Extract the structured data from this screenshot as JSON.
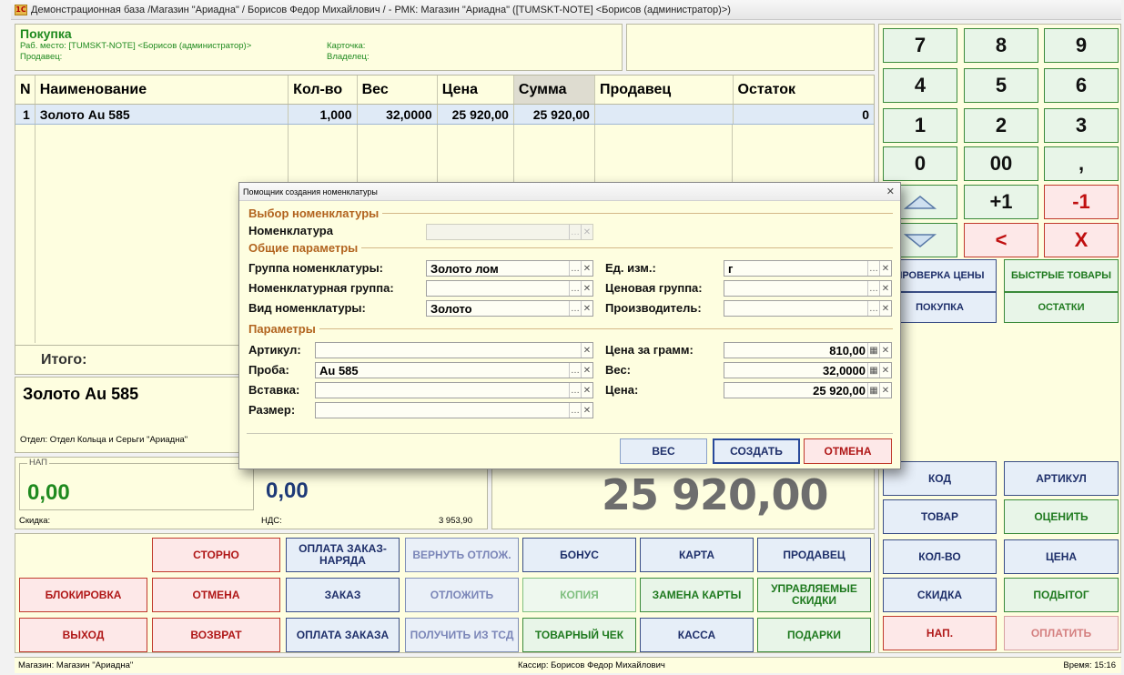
{
  "window": {
    "title": "Демонстрационная база /Магазин \"Ариадна\" / Борисов Федор Михайлович / - РМК: Магазин \"Ариадна\" ([TUMSKT-NOTE] <Борисов (администратор)>)",
    "icon": "1С"
  },
  "header": {
    "title": "Покупка",
    "workplace": "Раб. место: [TUMSKT-NOTE] <Борисов (администратор)>",
    "card": "Карточка:",
    "seller": "Продавец:",
    "owner": "Владелец:"
  },
  "table": {
    "columns": [
      "N",
      "Наименование",
      "Кол-во",
      "Вес",
      "Цена",
      "Сумма",
      "Продавец",
      "Остаток"
    ],
    "rows": [
      {
        "n": "1",
        "name": "Золото Au 585",
        "qty": "1,000",
        "weight": "32,0000",
        "price": "25 920,00",
        "sum": "25 920,00",
        "seller": "",
        "rest": "0"
      }
    ],
    "total_label": "Итого:"
  },
  "info": {
    "item_name": "Золото Au 585",
    "department": "Отдел: Отдел Кольца и Серьги \"Ариадна\""
  },
  "amounts": {
    "nap_label": "НАП",
    "nap_value": "0,00",
    "second_value": "0,00",
    "discount_label": "Скидка:",
    "vat_label": "НДС:",
    "vat_value": "3 953,90",
    "total": "25 920,00"
  },
  "actions": {
    "storno": "СТОРНО",
    "pay_order": "ОПЛАТА ЗАКАЗ-НАРЯДА",
    "return_deferred": "ВЕРНУТЬ ОТЛОЖ.",
    "bonus": "БОНУС",
    "card": "КАРТА",
    "seller": "ПРОДАВЕЦ",
    "block": "БЛОКИРОВКА",
    "cancel": "ОТМЕНА",
    "order": "ЗАКАЗ",
    "defer": "ОТЛОЖИТЬ",
    "copy": "КОПИЯ",
    "change_card": "ЗАМЕНА КАРТЫ",
    "managed_discounts": "УПРАВЛЯЕМЫЕ СКИДКИ",
    "exit": "ВЫХОД",
    "return": "ВОЗВРАТ",
    "pay_ord": "ОПЛАТА ЗАКАЗА",
    "get_tsd": "ПОЛУЧИТЬ ИЗ ТСД",
    "receipt": "ТОВАРНЫЙ ЧЕК",
    "cash": "КАССА",
    "gifts": "ПОДАРКИ"
  },
  "keypad": {
    "k7": "7",
    "k8": "8",
    "k9": "9",
    "k4": "4",
    "k5": "5",
    "k6": "6",
    "k1": "1",
    "k2": "2",
    "k3": "3",
    "k0": "0",
    "k00": "00",
    "kcomma": ",",
    "plus1": "+1",
    "minus1": "-1",
    "less": "<",
    "x": "X",
    "check_price": "ПРОВЕРКА ЦЕНЫ",
    "quick_goods": "БЫСТРЫЕ ТОВАРЫ",
    "purchase": "ПОКУПКА",
    "remains": "ОСТАТКИ",
    "code": "КОД",
    "article": "АРТИКУЛ",
    "goods": "ТОВАР",
    "evaluate": "ОЦЕНИТЬ",
    "qty": "КОЛ-ВО",
    "price": "ЦЕНА",
    "discount": "СКИДКА",
    "subtotal": "ПОДЫТОГ",
    "nap": "НАП.",
    "pay": "ОПЛАТИТЬ"
  },
  "status": {
    "shop": "Магазин: Магазин \"Ариадна\"",
    "cashier": "Кассир: Борисов Федор Михайлович",
    "time": "Время:  15:16"
  },
  "dialog": {
    "title": "Помощник создания номенклатуры",
    "section_select": "Выбор номенклатуры",
    "nomenclature_label": "Номенклатура",
    "section_general": "Общие параметры",
    "group_label": "Группа номенклатуры:",
    "group_value": "Золото лом",
    "nom_group_label": "Номенклатурная группа:",
    "nom_group_value": "",
    "kind_label": "Вид номенклатуры:",
    "kind_value": "Золото",
    "unit_label": "Ед. изм.:",
    "unit_value": "г",
    "price_group_label": "Ценовая группа:",
    "price_group_value": "",
    "manufacturer_label": "Производитель:",
    "manufacturer_value": "",
    "section_params": "Параметры",
    "article_label": "Артикул:",
    "article_value": "",
    "probe_label": "Проба:",
    "probe_value": "Au 585",
    "insert_label": "Вставка:",
    "insert_value": "",
    "size_label": "Размер:",
    "size_value": "",
    "price_gram_label": "Цена за грамм:",
    "price_gram_value": "810,00",
    "weight_label": "Вес:",
    "weight_value": "32,0000",
    "price_label": "Цена:",
    "price_value": "25 920,00",
    "btn_weight": "ВЕС",
    "btn_create": "СОЗДАТЬ",
    "btn_cancel": "ОТМЕНА"
  }
}
